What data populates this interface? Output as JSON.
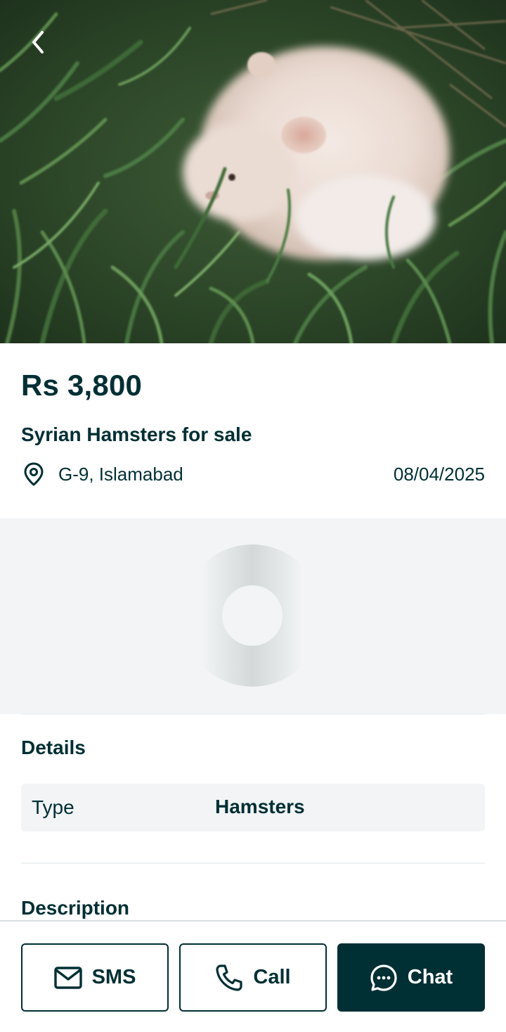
{
  "listing": {
    "price": "Rs 3,800",
    "title": "Syrian Hamsters for sale",
    "location": "G-9, Islamabad",
    "date": "08/04/2025"
  },
  "details": {
    "heading": "Details",
    "rows": [
      {
        "key": "Type",
        "value": "Hamsters"
      }
    ]
  },
  "description": {
    "heading": "Description"
  },
  "actions": {
    "sms_label": "SMS",
    "call_label": "Call",
    "chat_label": "Chat"
  },
  "icons": {
    "back": "chevron-left-icon",
    "location": "map-pin-icon",
    "sms": "envelope-icon",
    "call": "phone-icon",
    "chat": "chat-bubble-icon",
    "loading": "spinner-icon"
  },
  "colors": {
    "brand_dark": "#002f34",
    "panel_bg": "#f2f4f5",
    "divider": "#d8dfe0"
  }
}
